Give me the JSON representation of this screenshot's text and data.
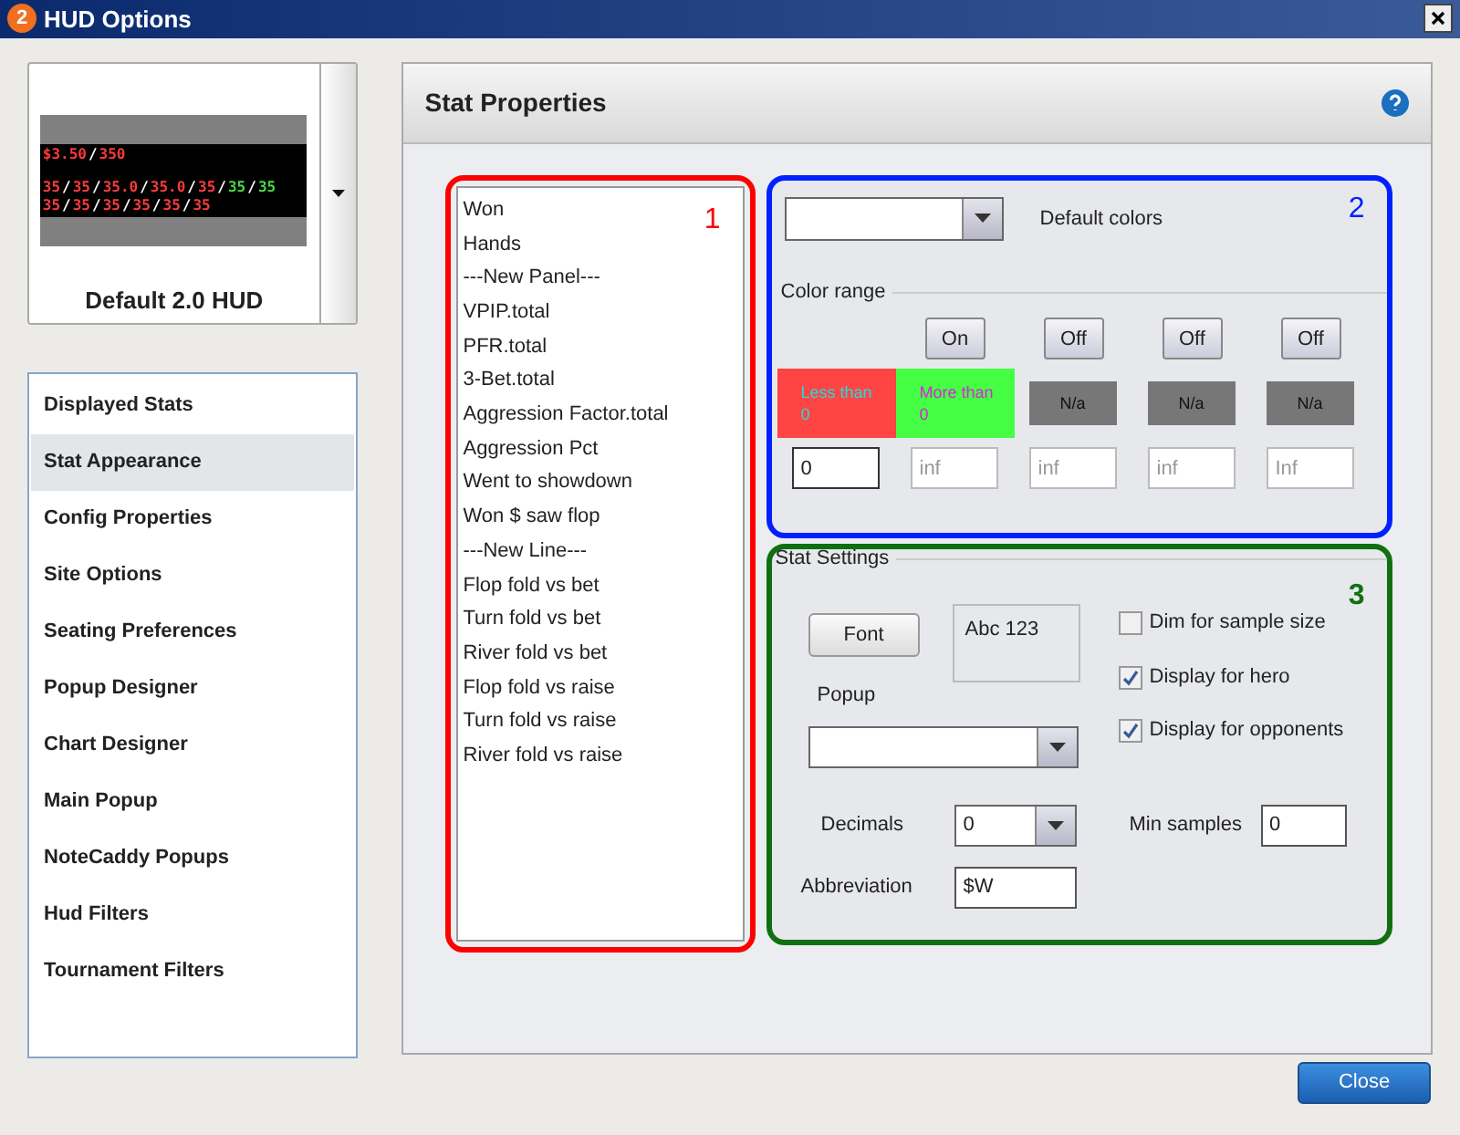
{
  "window": {
    "title": "HUD Options",
    "badge": "2"
  },
  "hud_preview": {
    "lines": [
      [
        {
          "text": "$3.50",
          "color": "#ff3b3b"
        },
        {
          "text": "/",
          "color": "#ffffff"
        },
        {
          "text": "350",
          "color": "#ff3b3b"
        }
      ],
      [
        {
          "text": "35",
          "color": "#ff3b3b"
        },
        {
          "text": "/",
          "color": "#ffffff"
        },
        {
          "text": "35",
          "color": "#ff3b3b"
        },
        {
          "text": "/",
          "color": "#ffffff"
        },
        {
          "text": "35.0",
          "color": "#ff3b3b"
        },
        {
          "text": "/",
          "color": "#ffffff"
        },
        {
          "text": "35.0",
          "color": "#ff3b3b"
        },
        {
          "text": "/",
          "color": "#ffffff"
        },
        {
          "text": "35",
          "color": "#ff3b3b"
        },
        {
          "text": "/",
          "color": "#ffffff"
        },
        {
          "text": "35",
          "color": "#44dd44"
        },
        {
          "text": "/",
          "color": "#ffffff"
        },
        {
          "text": "35",
          "color": "#44dd44"
        }
      ],
      [
        {
          "text": "35",
          "color": "#ff3b3b"
        },
        {
          "text": "/",
          "color": "#ffffff"
        },
        {
          "text": "35",
          "color": "#ff3b3b"
        },
        {
          "text": "/",
          "color": "#ffffff"
        },
        {
          "text": "35",
          "color": "#ff3b3b"
        },
        {
          "text": "/",
          "color": "#ffffff"
        },
        {
          "text": "35",
          "color": "#ff3b3b"
        },
        {
          "text": "/",
          "color": "#ffffff"
        },
        {
          "text": "35",
          "color": "#ff3b3b"
        },
        {
          "text": "/",
          "color": "#ffffff"
        },
        {
          "text": "35",
          "color": "#ff3b3b"
        }
      ]
    ],
    "name": "Default 2.0 HUD"
  },
  "sidebar": {
    "items": [
      {
        "label": "Displayed Stats",
        "selected": false
      },
      {
        "label": "Stat Appearance",
        "selected": true
      },
      {
        "label": "Config Properties",
        "selected": false
      },
      {
        "label": "Site Options",
        "selected": false
      },
      {
        "label": "Seating Preferences",
        "selected": false
      },
      {
        "label": "Popup Designer",
        "selected": false
      },
      {
        "label": "Chart Designer",
        "selected": false
      },
      {
        "label": "Main Popup",
        "selected": false
      },
      {
        "label": "NoteCaddy Popups",
        "selected": false
      },
      {
        "label": "Hud Filters",
        "selected": false
      },
      {
        "label": "Tournament Filters",
        "selected": false
      }
    ]
  },
  "panel": {
    "title": "Stat Properties"
  },
  "stat_list": {
    "number": "1",
    "items": [
      "Won",
      "Hands",
      "---New Panel---",
      "VPIP.total",
      "PFR.total",
      "3-Bet.total",
      "Aggression Factor.total",
      "Aggression Pct",
      "Went to showdown",
      "Won $ saw flop",
      "---New Line---",
      "Flop fold vs bet",
      "Turn fold vs bet",
      "River fold vs bet",
      "Flop fold vs raise",
      "Turn fold vs raise",
      "River fold vs raise"
    ]
  },
  "colors": {
    "number": "2",
    "default_colors_label": "Default colors",
    "color_range_label": "Color range",
    "toggles": [
      "On",
      "Off",
      "Off",
      "Off"
    ],
    "ranges": [
      {
        "kind": "range",
        "lines": [
          "Less than",
          "0"
        ],
        "color": "#ff4444"
      },
      {
        "kind": "range",
        "lines": [
          "More than",
          "0"
        ],
        "color": "#44ff44"
      },
      {
        "kind": "na",
        "lines": [
          "N/a"
        ]
      },
      {
        "kind": "na",
        "lines": [
          "N/a"
        ]
      },
      {
        "kind": "na",
        "lines": [
          "N/a"
        ]
      }
    ],
    "thresholds": [
      {
        "value": "0"
      },
      {
        "placeholder": "inf"
      },
      {
        "placeholder": "inf"
      },
      {
        "placeholder": "inf"
      },
      {
        "placeholder": "Inf"
      }
    ]
  },
  "stat_settings": {
    "number": "3",
    "title": "Stat Settings",
    "font_button": "Font",
    "font_sample": "Abc 123",
    "popup_label": "Popup",
    "checkboxes": [
      {
        "label": "Dim for sample size",
        "checked": false
      },
      {
        "label": "Display for hero",
        "checked": true
      },
      {
        "label": "Display for opponents",
        "checked": true
      }
    ],
    "decimals_label": "Decimals",
    "decimals": "0",
    "min_samples_label": "Min samples",
    "min_samples": "0",
    "abbreviation_label": "Abbreviation",
    "abbreviation": "$W"
  },
  "buttons": {
    "close": "Close"
  }
}
